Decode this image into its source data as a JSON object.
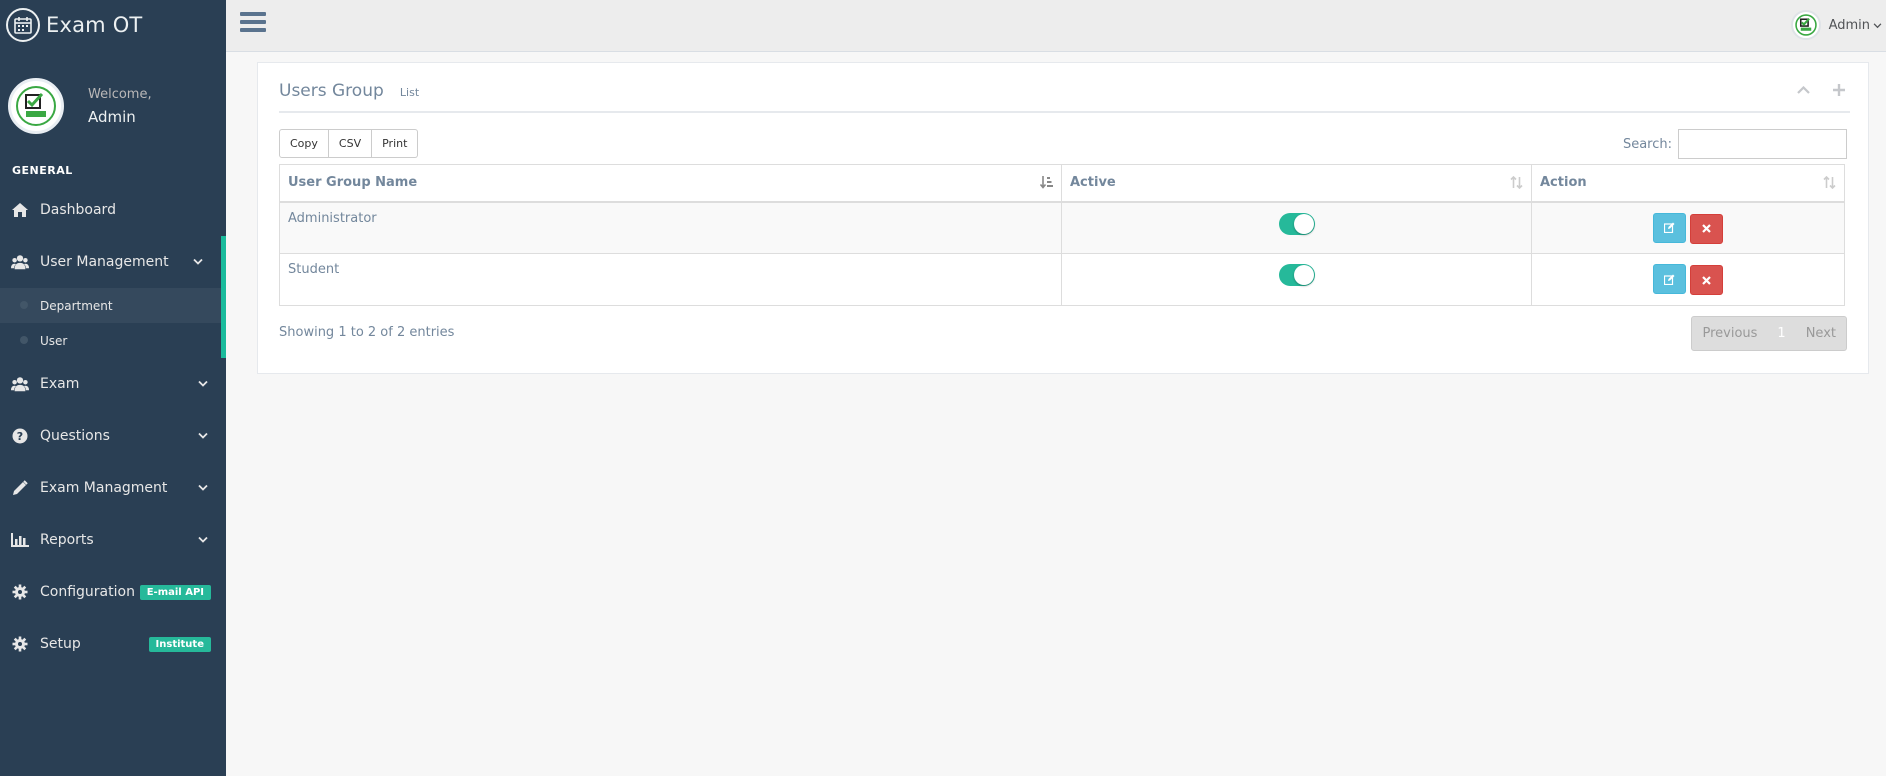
{
  "sidebar": {
    "brand_title": "Exam OT",
    "welcome": "Welcome,",
    "user_name": "Admin",
    "section_title": "GENERAL",
    "items": [
      {
        "label": "Dashboard",
        "icon": "home-icon"
      },
      {
        "label": "User Management",
        "icon": "users-icon",
        "expanded": true,
        "children": [
          {
            "label": "Department"
          },
          {
            "label": "User"
          }
        ]
      },
      {
        "label": "Exam",
        "icon": "users-icon"
      },
      {
        "label": "Questions",
        "icon": "question-circle-icon"
      },
      {
        "label": "Exam Managment",
        "icon": "pencil-icon"
      },
      {
        "label": "Reports",
        "icon": "bar-chart-icon"
      },
      {
        "label": "Configuration",
        "icon": "gear-icon",
        "badge": "E-mail  API"
      },
      {
        "label": "Setup",
        "icon": "gear-icon",
        "badge": "Institute"
      }
    ]
  },
  "topnav": {
    "user_name": "Admin"
  },
  "panel": {
    "title": "Users Group",
    "subtitle": "List",
    "export_buttons": [
      "Copy",
      "CSV",
      "Print"
    ],
    "search_label": "Search:",
    "search_value": "",
    "columns": [
      "User Group Name",
      "Active",
      "Action"
    ],
    "rows": [
      {
        "name": "Administrator",
        "active": true
      },
      {
        "name": "Student",
        "active": true
      }
    ],
    "info": "Showing 1 to 2 of 2 entries",
    "pagination": {
      "previous": "Previous",
      "page": "1",
      "next": "Next"
    }
  },
  "colors": {
    "sidebar_bg": "#2a3f54",
    "accent": "#1abb9c",
    "toggle_on": "#26b99a",
    "edit_btn": "#5bc0de",
    "delete_btn": "#d9534f"
  }
}
